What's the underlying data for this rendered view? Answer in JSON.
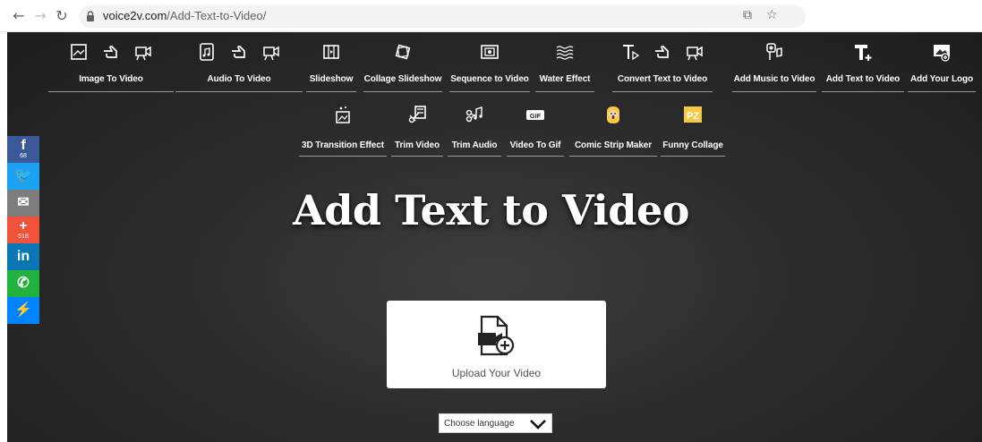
{
  "browser": {
    "url_host": "voice2v.com",
    "url_path": "/Add-Text-to-Video/"
  },
  "menu_row1": [
    {
      "label": "Image To Video",
      "icons": [
        "image-icon",
        "pointing-hand-icon",
        "video-camera-icon"
      ]
    },
    {
      "label": "Audio To Video",
      "icons": [
        "audio-file-icon",
        "pointing-hand-icon",
        "video-camera-icon"
      ]
    },
    {
      "label": "Slideshow",
      "icons": [
        "slideshow-icon"
      ]
    },
    {
      "label": "Collage Slideshow",
      "icons": [
        "collage-icon"
      ]
    },
    {
      "label": "Sequence to Video",
      "icons": [
        "sequence-icon"
      ]
    },
    {
      "label": "Water Effect",
      "icons": [
        "water-icon"
      ]
    },
    {
      "label": "Convert Text to Video",
      "icons": [
        "text-icon",
        "pointing-hand-icon",
        "video-camera-icon"
      ]
    },
    {
      "label": "Add Music to Video",
      "icons": [
        "music-icon"
      ]
    },
    {
      "label": "Add Text to Video",
      "icons": [
        "add-text-icon"
      ]
    },
    {
      "label": "Add Your Logo",
      "icons": [
        "logo-icon"
      ]
    }
  ],
  "menu_row2": [
    {
      "label": "3D Transition Effect",
      "icons": [
        "transition-icon"
      ]
    },
    {
      "label": "Trim Video",
      "icons": [
        "trim-video-icon"
      ]
    },
    {
      "label": "Trim Audio",
      "icons": [
        "trim-audio-icon"
      ]
    },
    {
      "label": "Video To Gif",
      "icons": [
        "gif-icon"
      ]
    },
    {
      "label": "Comic Strip Maker",
      "icons": [
        "comic-icon"
      ]
    },
    {
      "label": "Funny Collage",
      "icons": [
        "funny-collage-icon"
      ]
    }
  ],
  "gif_badge": "GIF",
  "pz_badge": "PZ",
  "page_title": "Add Text to Video",
  "upload": {
    "label": "Upload Your Video"
  },
  "language": {
    "selected": "Choose language"
  },
  "social": [
    {
      "name": "facebook",
      "glyph": "f",
      "count": "68",
      "color": "#3b5998"
    },
    {
      "name": "twitter",
      "glyph": "🐦",
      "count": "",
      "color": "#1da1f2"
    },
    {
      "name": "email",
      "glyph": "✉",
      "count": "",
      "color": "#7d7d7d"
    },
    {
      "name": "share",
      "glyph": "+",
      "count": "518",
      "color": "#f0523a"
    },
    {
      "name": "linkedin",
      "glyph": "in",
      "count": "",
      "color": "#0a76b6"
    },
    {
      "name": "whatsapp",
      "glyph": "✆",
      "count": "",
      "color": "#22b13c"
    },
    {
      "name": "messenger",
      "glyph": "⚡",
      "count": "",
      "color": "#0084ff"
    }
  ]
}
